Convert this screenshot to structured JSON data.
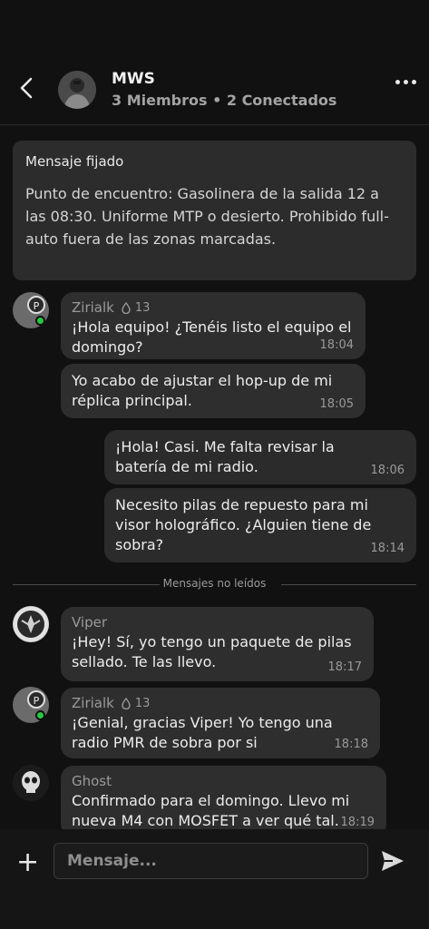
{
  "header": {
    "title": "MWS",
    "subtitle": "3 Miembros • 2 Conectados",
    "back_icon": "chevron-left-icon",
    "more_icon": "more-dots-icon"
  },
  "pinned": {
    "title": "Mensaje fijado",
    "text": "Punto de encuentro: Gasolinera de la salida 12 a las 08:30. Uniforme MTP o desierto. Prohibido full-auto fuera de las zonas marcadas."
  },
  "messages": [
    {
      "sender": "Zirialk",
      "reputation": "13",
      "text": "¡Hola equipo! ¿Tenéis listo el equipo el domingo?",
      "time": "18:04"
    },
    {
      "text": "Yo acabo de ajustar el hop-up de mi réplica principal.",
      "time": "18:05"
    },
    {
      "text": "¡Hola! Casi. Me falta revisar la batería de mi radio.",
      "time": "18:06"
    },
    {
      "text": "Necesito pilas de repuesto para mi visor holográfico. ¿Alguien tiene de sobra?",
      "time": "18:14"
    },
    {
      "sender": "Viper",
      "text": "¡Hey! Sí, yo tengo un paquete de pilas sellado. Te las llevo.",
      "time": "18:17"
    },
    {
      "sender": "Zirialk",
      "reputation": "13",
      "text": "¡Genial, gracias Viper! Yo tengo una radio PMR de sobra por si",
      "time": "18:18"
    },
    {
      "sender": "Ghost",
      "text": "Confirmado para el domingo. Llevo mi nueva M4 con MOSFET a ver qué tal.",
      "time": "18:19"
    }
  ],
  "divider_label": "Mensajes no leídos",
  "composer": {
    "placeholder": "Mensaje...",
    "add_icon": "plus-icon",
    "send_icon": "send-icon"
  },
  "colors": {
    "background": "#111111",
    "bubble": "#2e2e2e",
    "online": "#28c840"
  }
}
